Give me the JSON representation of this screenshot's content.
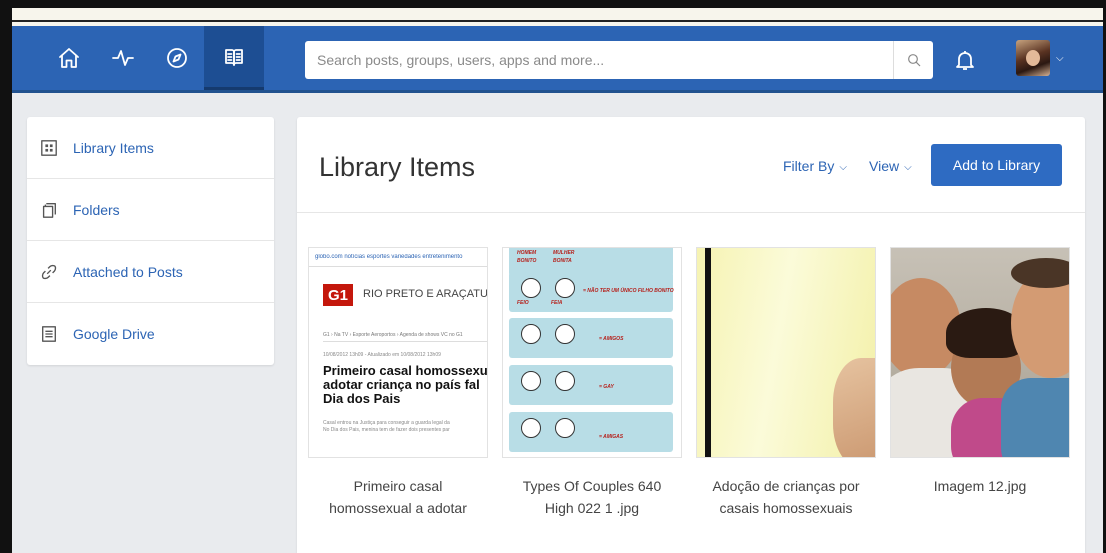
{
  "nav": {
    "icons": [
      "home-icon",
      "activity-icon",
      "compass-icon",
      "library-icon"
    ],
    "active": "library-icon"
  },
  "search": {
    "placeholder": "Search posts, groups, users, apps and more..."
  },
  "sidebar": {
    "items": [
      {
        "label": "Library Items",
        "icon": "grid-icon"
      },
      {
        "label": "Folders",
        "icon": "folders-icon"
      },
      {
        "label": "Attached to Posts",
        "icon": "link-icon"
      },
      {
        "label": "Google Drive",
        "icon": "document-icon"
      }
    ]
  },
  "main": {
    "title": "Library Items",
    "filter_label": "Filter By",
    "view_label": "View",
    "add_label": "Add to Library"
  },
  "items": [
    {
      "title_line1": "Primeiro casal",
      "title_line2": "homossexual a adotar",
      "thumb": {
        "topbar": "globo.com  notícias  esportes  variedades  entretenimento",
        "logo": "G1",
        "city": "RIO PRETO E ARAÇATUBA",
        "nav": "G1 ›  Na TV ›  Esporte   Aeroportos ›   Agenda de shows   VC no G1",
        "small": "10/08/2012 13h09 - Atualizado em 10/08/2012 13h09",
        "headline1": "Primeiro casal homossexu",
        "headline2": "adotar criança no país fal",
        "headline3": "Dia dos Pais",
        "body1": "Casal entrou na Justiça para conseguir a guarda legal da",
        "body2": "No Dia dos Pais, menina tem de fazer dois presentes par"
      }
    },
    {
      "title_line1": "Types Of Couples 640",
      "title_line2": "High 022 1 .jpg",
      "thumb": {
        "labels": [
          "HOMEM",
          "MULHER",
          "BONITO",
          "BONITA",
          "FEIO",
          "FEIA",
          "= NÃO TER UM ÚNICO FILHO BONITO",
          "= AMIGOS",
          "= GAY",
          "= AMIGAS"
        ]
      }
    },
    {
      "title_line1": "Adoção de crianças por",
      "title_line2": "casais homossexuais"
    },
    {
      "title_line1": "Imagem 12.jpg",
      "title_line2": ""
    }
  ],
  "colors": {
    "topbar": "#2c64b4",
    "accent": "#2e6bc2",
    "link": "#2c64b4",
    "background": "#e9ebee"
  }
}
